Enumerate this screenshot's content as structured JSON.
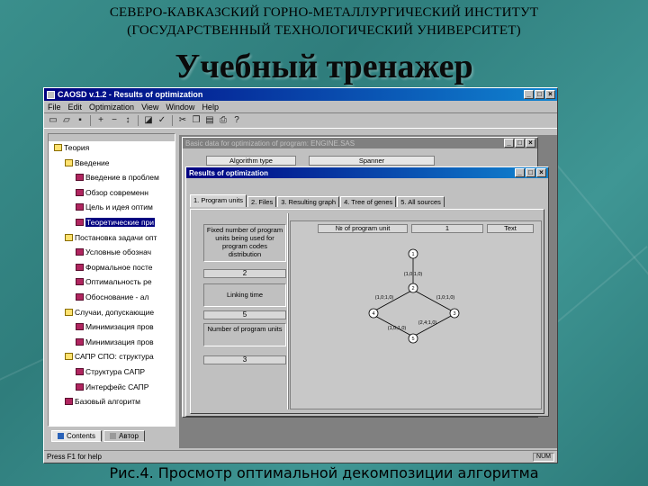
{
  "slide": {
    "header_line1": "СЕВЕРО-КАВКАЗСКИЙ ГОРНО-МЕТАЛЛУРГИЧЕСКИЙ ИНСТИТУТ",
    "header_line2": "(ГОСУДАРСТВЕННЫЙ ТЕХНОЛОГИЧЕСКИЙ УНИВЕРСИТЕТ)",
    "title": "Учебный тренажер",
    "caption": "Рис.4. Просмотр оптимальной декомпозиции алгоритма"
  },
  "app": {
    "title": "CAOSD v.1.2 - Results of optimization",
    "menu": [
      "File",
      "Edit",
      "Optimization",
      "View",
      "Window",
      "Help"
    ],
    "toolbar_icons": [
      "new-icon",
      "open-icon",
      "save-icon",
      "add-icon",
      "remove-icon",
      "move-icon",
      "build-icon",
      "optimize-icon",
      "cut-icon",
      "copy-icon",
      "paste-icon",
      "print-icon",
      "help-icon"
    ],
    "status": "Press F1 for help",
    "status_num": "NUM"
  },
  "tree": {
    "items": [
      {
        "label": "Теория",
        "icon": "folder"
      },
      {
        "label": "Введение",
        "icon": "folder"
      },
      {
        "label": "Введение в проблем",
        "icon": "book"
      },
      {
        "label": "Обзор современн",
        "icon": "book"
      },
      {
        "label": "Цель и идея оптим",
        "icon": "book"
      },
      {
        "label": "Теоретические при",
        "icon": "book",
        "selected": true
      },
      {
        "label": "Постановка задачи опт",
        "icon": "folder"
      },
      {
        "label": "Условные обознач",
        "icon": "book"
      },
      {
        "label": "Формальное посте",
        "icon": "book"
      },
      {
        "label": "Оптимальность ре",
        "icon": "book"
      },
      {
        "label": "Обоснование - ал",
        "icon": "book"
      },
      {
        "label": "Случаи, допускающие",
        "icon": "folder"
      },
      {
        "label": "Минимизация пров",
        "icon": "book"
      },
      {
        "label": "Минимизация пров",
        "icon": "book"
      },
      {
        "label": "САПР СПО: структура",
        "icon": "folder"
      },
      {
        "label": "Структура САПР",
        "icon": "book"
      },
      {
        "label": "Интерфейс САПР",
        "icon": "book"
      },
      {
        "label": "Базовый алгоритм",
        "icon": "book"
      }
    ],
    "tabs": [
      "Contents",
      "Автор"
    ]
  },
  "child1": {
    "title": "Basic data for optimization of program: ENGINE.SAS",
    "field1": "Algorithm type",
    "field2": "Spanner"
  },
  "child2": {
    "title": "Results of optimization",
    "tabs": [
      "1. Program units",
      "2. Files",
      "3. Resulting graph",
      "4. Tree of genes",
      "5. All sources"
    ],
    "boxes": [
      {
        "label": "Fixed number of program units being used for program codes distribution",
        "value": "2"
      },
      {
        "label": "Linking time",
        "value": "5"
      },
      {
        "label": "Number of program units",
        "value": "3"
      }
    ],
    "graph_header": [
      "№ of program unit",
      "1",
      "Text"
    ],
    "graph": {
      "nodes": [
        "1",
        "2",
        "3",
        "4",
        "5"
      ],
      "edge_labels": [
        "(1,0;1,0)",
        "(1,0;1,0)",
        "(1,0;1,0)",
        "(2,4;1,0)",
        "(1,0;1,0)"
      ]
    }
  }
}
